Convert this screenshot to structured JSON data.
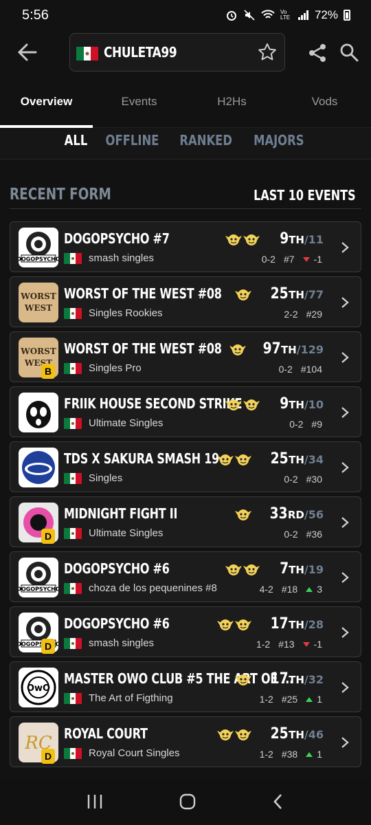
{
  "status": {
    "time": "5:56",
    "battery": "72%",
    "network": "Vo LTE"
  },
  "header": {
    "player_name": "CHULETA99"
  },
  "tabs": [
    "Overview",
    "Events",
    "H2Hs",
    "Vods"
  ],
  "filters": [
    "ALL",
    "OFFLINE",
    "RANKED",
    "MAJORS"
  ],
  "section": {
    "title": "RECENT FORM",
    "right": "LAST 10 EVENTS"
  },
  "colors": {
    "accent": "#f2c012",
    "muted_blue": "#6f7f91",
    "up": "#3bd35c",
    "down": "#e33b3b"
  },
  "events": [
    {
      "title": "DOGOPSYCHO #7",
      "bracket": "smash singles",
      "place": "9",
      "ord": "TH",
      "total": "/11",
      "record": "0-2",
      "seed": "#7",
      "delta": "-1",
      "dir": "down",
      "tier": "",
      "logo": "dogopsycho",
      "chars": 2
    },
    {
      "title": "WORST OF THE WEST #08",
      "bracket": "Singles Rookies",
      "place": "25",
      "ord": "TH",
      "total": "/77",
      "record": "2-2",
      "seed": "#29",
      "delta": "",
      "dir": "",
      "tier": "",
      "logo": "worst",
      "chars": 1
    },
    {
      "title": "WORST OF THE WEST #08",
      "bracket": "Singles Pro",
      "place": "97",
      "ord": "TH",
      "total": "/129",
      "record": "0-2",
      "seed": "#104",
      "delta": "",
      "dir": "",
      "tier": "B",
      "logo": "worst",
      "chars": 1
    },
    {
      "title": "FRIIK HOUSE SECOND STRIKE",
      "bracket": "Ultimate Singles",
      "place": "9",
      "ord": "TH",
      "total": "/10",
      "record": "0-2",
      "seed": "#9",
      "delta": "",
      "dir": "",
      "tier": "",
      "logo": "friik",
      "chars": 2
    },
    {
      "title": "TDS X SAKURA SMASH 19",
      "bracket": "Singles",
      "place": "25",
      "ord": "TH",
      "total": "/34",
      "record": "0-2",
      "seed": "#30",
      "delta": "",
      "dir": "",
      "tier": "",
      "logo": "tds",
      "chars": 2
    },
    {
      "title": "MIDNIGHT FIGHT II",
      "bracket": "Ultimate Singles",
      "place": "33",
      "ord": "RD",
      "total": "/56",
      "record": "0-2",
      "seed": "#36",
      "delta": "",
      "dir": "",
      "tier": "D",
      "logo": "midnight",
      "chars": 1
    },
    {
      "title": "DOGOPSYCHO #6",
      "bracket": "choza de los pequenines #8",
      "place": "7",
      "ord": "TH",
      "total": "/19",
      "record": "4-2",
      "seed": "#18",
      "delta": "3",
      "dir": "up",
      "tier": "",
      "logo": "dogopsycho",
      "chars": 2
    },
    {
      "title": "DOGOPSYCHO #6",
      "bracket": "smash singles",
      "place": "17",
      "ord": "TH",
      "total": "/28",
      "record": "1-2",
      "seed": "#13",
      "delta": "-1",
      "dir": "down",
      "tier": "D",
      "logo": "dogopsycho",
      "chars": 2
    },
    {
      "title": "MASTER OWO CLUB #5 THE ART OF ...",
      "bracket": "The Art of Figthing",
      "place": "17",
      "ord": "TH",
      "total": "/32",
      "record": "1-2",
      "seed": "#25",
      "delta": "1",
      "dir": "up",
      "tier": "",
      "logo": "owo",
      "chars": 1
    },
    {
      "title": "ROYAL COURT",
      "bracket": "Royal Court Singles",
      "place": "25",
      "ord": "TH",
      "total": "/46",
      "record": "1-2",
      "seed": "#38",
      "delta": "1",
      "dir": "up",
      "tier": "D",
      "logo": "royal",
      "chars": 2
    }
  ]
}
